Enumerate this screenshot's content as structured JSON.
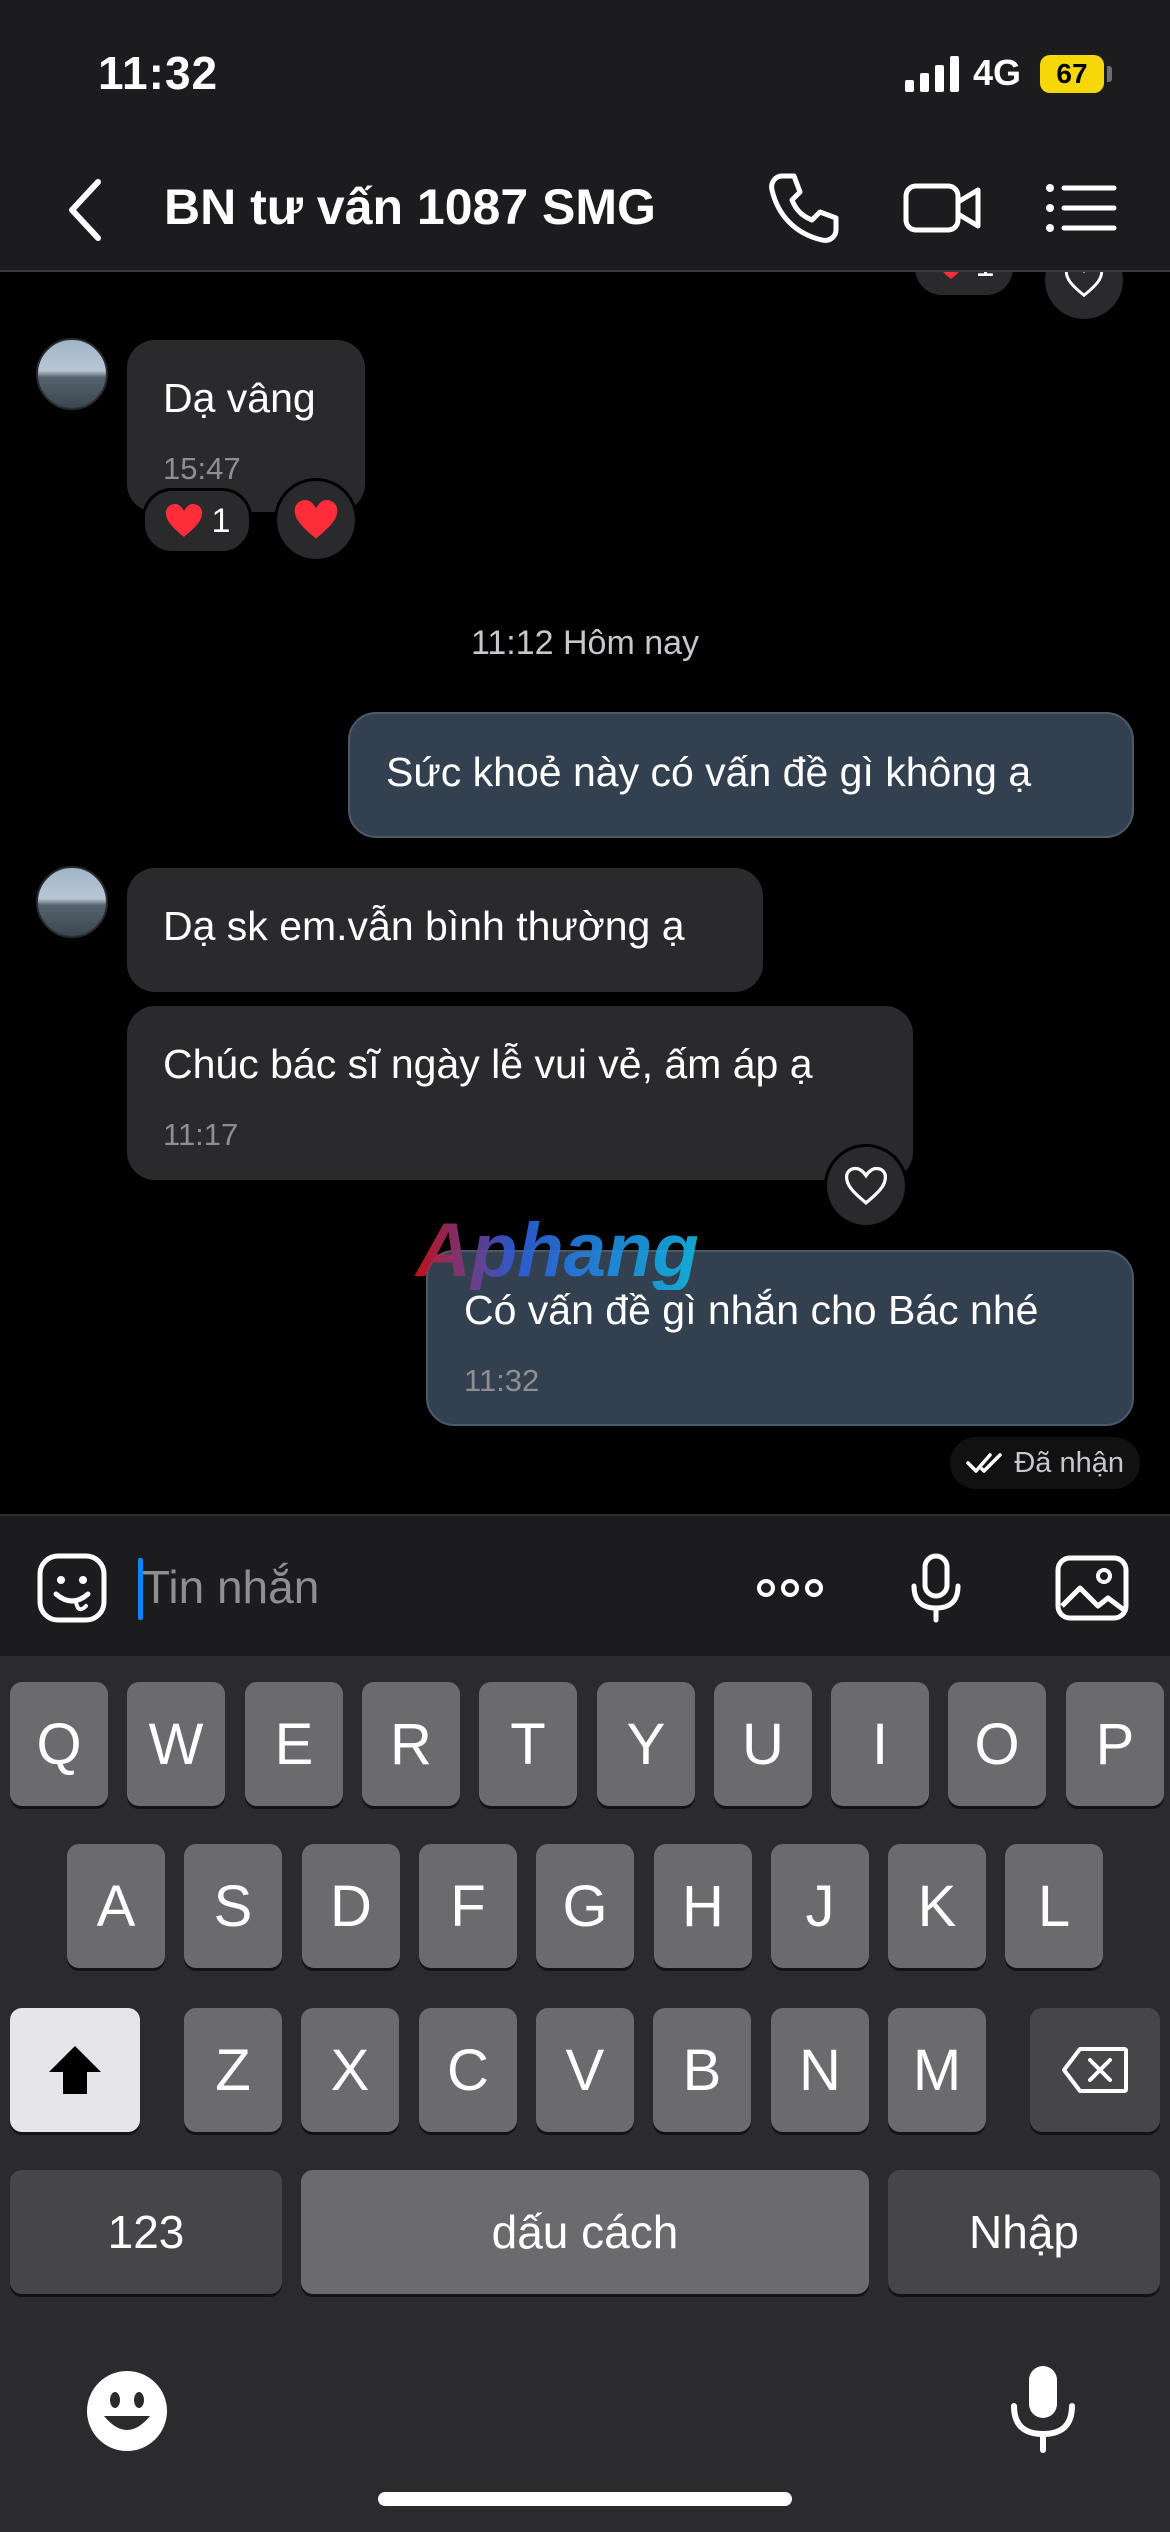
{
  "status_bar": {
    "time": "11:32",
    "network": "4G",
    "battery": "67"
  },
  "header": {
    "title": "BN tư vấn 1087 SMG"
  },
  "chat": {
    "top_reaction_count": "1",
    "messages": [
      {
        "text": "Dạ vâng",
        "time": "15:47",
        "reaction_count": "1"
      },
      {
        "date_divider": "11:12 Hôm nay"
      },
      {
        "text": "Sức khoẻ này có vấn đề gì không ạ"
      },
      {
        "text": "Dạ sk em.vẫn bình thường ạ"
      },
      {
        "text": "Chúc bác sĩ ngày lễ vui vẻ, ấm áp ạ",
        "time": "11:17"
      },
      {
        "text": "Có vấn đề gì nhắn cho Bác nhé",
        "time": "11:32"
      }
    ],
    "delivery_status": "Đã nhận",
    "watermark": "Aphang"
  },
  "input": {
    "placeholder": "Tin nhắn"
  },
  "keyboard": {
    "row1": [
      "Q",
      "W",
      "E",
      "R",
      "T",
      "Y",
      "U",
      "I",
      "O",
      "P"
    ],
    "row2": [
      "A",
      "S",
      "D",
      "F",
      "G",
      "H",
      "J",
      "K",
      "L"
    ],
    "row3": [
      "Z",
      "X",
      "C",
      "V",
      "B",
      "N",
      "M"
    ],
    "numbers_key": "123",
    "space_key": "dấu cách",
    "return_key": "Nhập"
  },
  "colors": {
    "background": "#000000",
    "bar": "#1c1c1e",
    "incoming_bubble": "#2a2a2c",
    "outgoing_bubble": "#33404f",
    "battery": "#f5d70a",
    "caret": "#0a84ff",
    "heart": "#ff2d3a"
  }
}
